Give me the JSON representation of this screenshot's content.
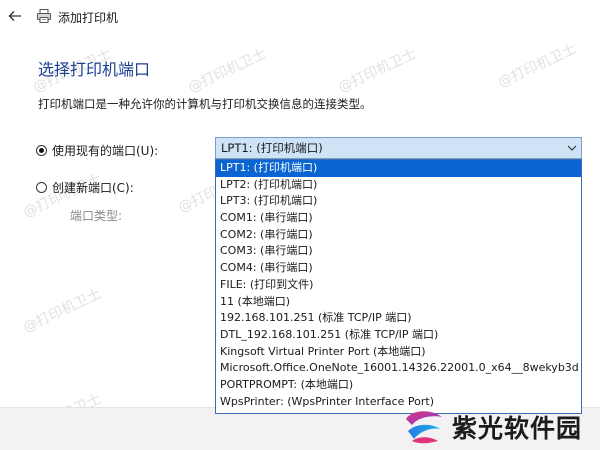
{
  "window": {
    "title": "添加打印机"
  },
  "heading": "选择打印机端口",
  "description": "打印机端口是一种允许你的计算机与打印机交换信息的连接类型。",
  "use_existing": {
    "label": "使用现有的端口(U):",
    "checked": true
  },
  "create_new": {
    "label": "创建新端口(C):",
    "checked": false
  },
  "port_type_label": "端口类型:",
  "combo": {
    "selected": "LPT1: (打印机端口)"
  },
  "dropdown": {
    "options": [
      "LPT1: (打印机端口)",
      "LPT2: (打印机端口)",
      "LPT3: (打印机端口)",
      "COM1: (串行端口)",
      "COM2: (串行端口)",
      "COM3: (串行端口)",
      "COM4: (串行端口)",
      "FILE: (打印到文件)",
      "11 (本地端口)",
      "192.168.101.251 (标准 TCP/IP 端口)",
      "DTL_192.168.101.251 (标准 TCP/IP 端口)",
      "Kingsoft Virtual Printer Port (本地端口)",
      "Microsoft.Office.OneNote_16001.14326.22001.0_x64__8wekyb3d",
      "PORTPROMPT: (本地端口)",
      "WpsPrinter: (WpsPrinter Interface Port)"
    ],
    "selected_index": 0
  },
  "watermark": "@打印机卫士",
  "logo": {
    "text": "紫光软件园"
  },
  "colors": {
    "heading": "#1c3f95",
    "selected_bg": "#0a64d2",
    "combo_bg": "#cfe3f7",
    "border": "#3b6cb5"
  },
  "icons": {
    "back": "back-arrow-icon",
    "printer": "printer-icon",
    "dropdown": "chevron-down-icon"
  }
}
